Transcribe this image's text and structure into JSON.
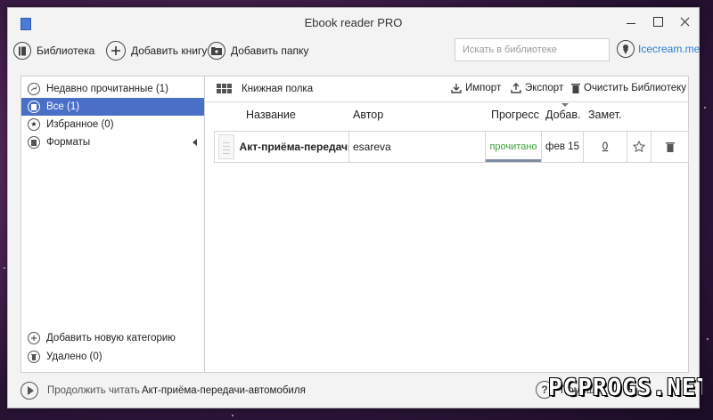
{
  "window": {
    "title": "Ebook reader PRO"
  },
  "toolbar": {
    "library": "Библиотека",
    "add_book": "Добавить книгу",
    "add_folder": "Добавить папку",
    "search_placeholder": "Искать в библиотеке",
    "brand_link": "Icecream.me"
  },
  "sidebar": {
    "items": [
      {
        "label": "Недавно прочитанные (1)",
        "icon": "clock-arrow-icon"
      },
      {
        "label": "Все (1)",
        "icon": "book-icon",
        "active": true
      },
      {
        "label": "Избранное (0)",
        "icon": "star-icon"
      },
      {
        "label": "Форматы",
        "icon": "book-icon"
      }
    ],
    "add_category": "Добавить новую категорию",
    "deleted": "Удалено (0)"
  },
  "shelf": {
    "label": "Книжная полка",
    "import": "Импорт",
    "export": "Экспорт",
    "clear": "Очистить Библиотеку"
  },
  "table": {
    "columns": {
      "name": "Название",
      "author": "Автор",
      "progress": "Прогресс",
      "added": "Добав.",
      "notes": "Замет."
    },
    "rows": [
      {
        "title": "Акт-приёма-передачи-автомобиля",
        "author": "esareva",
        "progress": "прочитано",
        "added": "фев 15",
        "notes": "0"
      }
    ]
  },
  "footer": {
    "continue_label": "Продолжить читать",
    "continue_book": "Акт-приёма-передачи-автомобиля",
    "help_label": "Помощь"
  },
  "watermark": "PCPROGS.NET",
  "colors": {
    "accent": "#4a6fc7",
    "link": "#2a7bd6",
    "progress_done": "#3aa33a"
  }
}
